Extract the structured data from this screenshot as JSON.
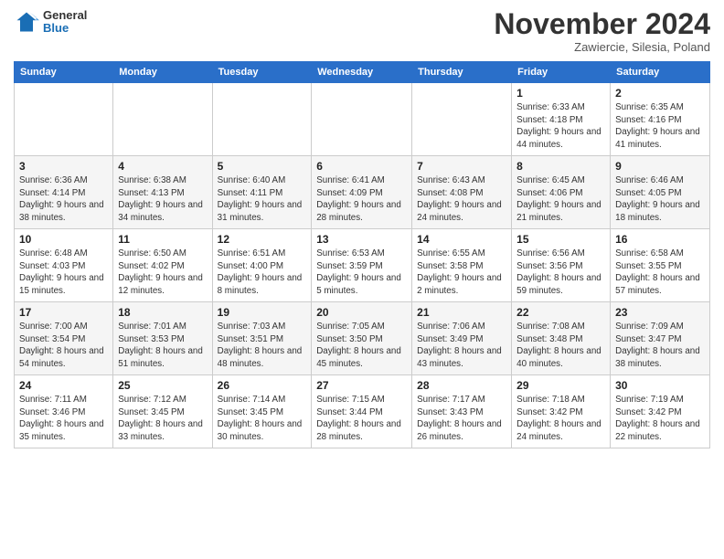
{
  "logo": {
    "general": "General",
    "blue": "Blue"
  },
  "title": "November 2024",
  "location": "Zawiercie, Silesia, Poland",
  "days_of_week": [
    "Sunday",
    "Monday",
    "Tuesday",
    "Wednesday",
    "Thursday",
    "Friday",
    "Saturday"
  ],
  "weeks": [
    [
      {
        "day": "",
        "info": ""
      },
      {
        "day": "",
        "info": ""
      },
      {
        "day": "",
        "info": ""
      },
      {
        "day": "",
        "info": ""
      },
      {
        "day": "",
        "info": ""
      },
      {
        "day": "1",
        "info": "Sunrise: 6:33 AM\nSunset: 4:18 PM\nDaylight: 9 hours\nand 44 minutes."
      },
      {
        "day": "2",
        "info": "Sunrise: 6:35 AM\nSunset: 4:16 PM\nDaylight: 9 hours\nand 41 minutes."
      }
    ],
    [
      {
        "day": "3",
        "info": "Sunrise: 6:36 AM\nSunset: 4:14 PM\nDaylight: 9 hours\nand 38 minutes."
      },
      {
        "day": "4",
        "info": "Sunrise: 6:38 AM\nSunset: 4:13 PM\nDaylight: 9 hours\nand 34 minutes."
      },
      {
        "day": "5",
        "info": "Sunrise: 6:40 AM\nSunset: 4:11 PM\nDaylight: 9 hours\nand 31 minutes."
      },
      {
        "day": "6",
        "info": "Sunrise: 6:41 AM\nSunset: 4:09 PM\nDaylight: 9 hours\nand 28 minutes."
      },
      {
        "day": "7",
        "info": "Sunrise: 6:43 AM\nSunset: 4:08 PM\nDaylight: 9 hours\nand 24 minutes."
      },
      {
        "day": "8",
        "info": "Sunrise: 6:45 AM\nSunset: 4:06 PM\nDaylight: 9 hours\nand 21 minutes."
      },
      {
        "day": "9",
        "info": "Sunrise: 6:46 AM\nSunset: 4:05 PM\nDaylight: 9 hours\nand 18 minutes."
      }
    ],
    [
      {
        "day": "10",
        "info": "Sunrise: 6:48 AM\nSunset: 4:03 PM\nDaylight: 9 hours\nand 15 minutes."
      },
      {
        "day": "11",
        "info": "Sunrise: 6:50 AM\nSunset: 4:02 PM\nDaylight: 9 hours\nand 12 minutes."
      },
      {
        "day": "12",
        "info": "Sunrise: 6:51 AM\nSunset: 4:00 PM\nDaylight: 9 hours\nand 8 minutes."
      },
      {
        "day": "13",
        "info": "Sunrise: 6:53 AM\nSunset: 3:59 PM\nDaylight: 9 hours\nand 5 minutes."
      },
      {
        "day": "14",
        "info": "Sunrise: 6:55 AM\nSunset: 3:58 PM\nDaylight: 9 hours\nand 2 minutes."
      },
      {
        "day": "15",
        "info": "Sunrise: 6:56 AM\nSunset: 3:56 PM\nDaylight: 8 hours\nand 59 minutes."
      },
      {
        "day": "16",
        "info": "Sunrise: 6:58 AM\nSunset: 3:55 PM\nDaylight: 8 hours\nand 57 minutes."
      }
    ],
    [
      {
        "day": "17",
        "info": "Sunrise: 7:00 AM\nSunset: 3:54 PM\nDaylight: 8 hours\nand 54 minutes."
      },
      {
        "day": "18",
        "info": "Sunrise: 7:01 AM\nSunset: 3:53 PM\nDaylight: 8 hours\nand 51 minutes."
      },
      {
        "day": "19",
        "info": "Sunrise: 7:03 AM\nSunset: 3:51 PM\nDaylight: 8 hours\nand 48 minutes."
      },
      {
        "day": "20",
        "info": "Sunrise: 7:05 AM\nSunset: 3:50 PM\nDaylight: 8 hours\nand 45 minutes."
      },
      {
        "day": "21",
        "info": "Sunrise: 7:06 AM\nSunset: 3:49 PM\nDaylight: 8 hours\nand 43 minutes."
      },
      {
        "day": "22",
        "info": "Sunrise: 7:08 AM\nSunset: 3:48 PM\nDaylight: 8 hours\nand 40 minutes."
      },
      {
        "day": "23",
        "info": "Sunrise: 7:09 AM\nSunset: 3:47 PM\nDaylight: 8 hours\nand 38 minutes."
      }
    ],
    [
      {
        "day": "24",
        "info": "Sunrise: 7:11 AM\nSunset: 3:46 PM\nDaylight: 8 hours\nand 35 minutes."
      },
      {
        "day": "25",
        "info": "Sunrise: 7:12 AM\nSunset: 3:45 PM\nDaylight: 8 hours\nand 33 minutes."
      },
      {
        "day": "26",
        "info": "Sunrise: 7:14 AM\nSunset: 3:45 PM\nDaylight: 8 hours\nand 30 minutes."
      },
      {
        "day": "27",
        "info": "Sunrise: 7:15 AM\nSunset: 3:44 PM\nDaylight: 8 hours\nand 28 minutes."
      },
      {
        "day": "28",
        "info": "Sunrise: 7:17 AM\nSunset: 3:43 PM\nDaylight: 8 hours\nand 26 minutes."
      },
      {
        "day": "29",
        "info": "Sunrise: 7:18 AM\nSunset: 3:42 PM\nDaylight: 8 hours\nand 24 minutes."
      },
      {
        "day": "30",
        "info": "Sunrise: 7:19 AM\nSunset: 3:42 PM\nDaylight: 8 hours\nand 22 minutes."
      }
    ]
  ]
}
